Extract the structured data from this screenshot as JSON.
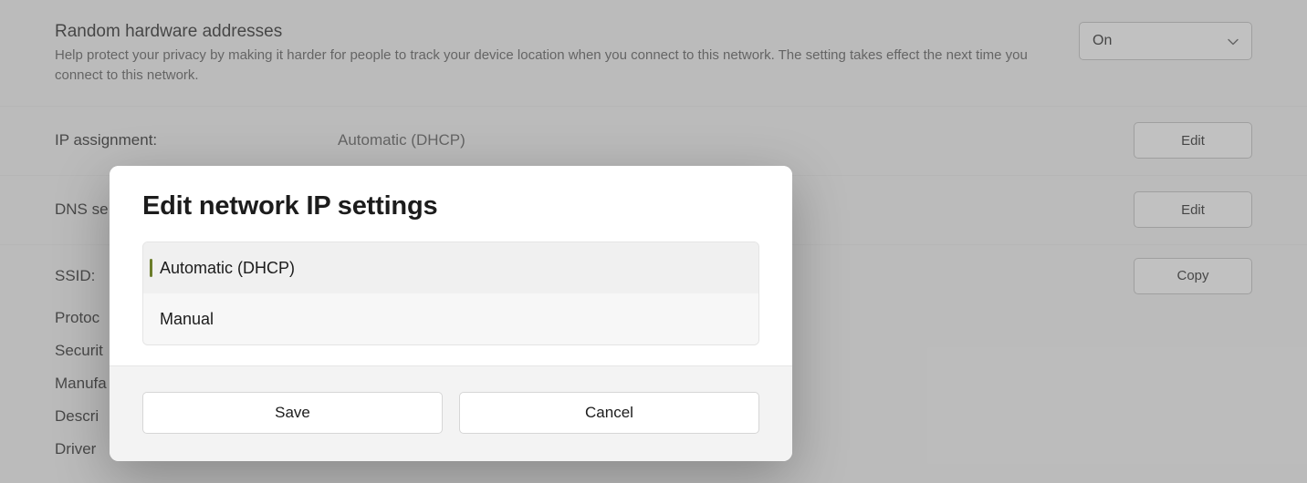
{
  "random_hw": {
    "title": "Random hardware addresses",
    "desc": "Help protect your privacy by making it harder for people to track your device location when you connect to this network. The setting takes effect the next time you connect to this network.",
    "toggle_value": "On"
  },
  "ip_assignment": {
    "label": "IP assignment:",
    "value": "Automatic (DHCP)",
    "button": "Edit"
  },
  "dns": {
    "label": "DNS se",
    "button": "Edit"
  },
  "props": {
    "ssid": "SSID:",
    "protocol": "Protoc",
    "security": "Securit",
    "manufacturer": "Manufa",
    "description": "Descri",
    "driver": "Driver",
    "copy_button": "Copy"
  },
  "dialog": {
    "title": "Edit network IP settings",
    "option_auto": "Automatic (DHCP)",
    "option_manual": "Manual",
    "save": "Save",
    "cancel": "Cancel"
  }
}
